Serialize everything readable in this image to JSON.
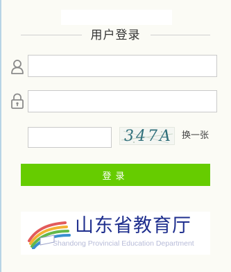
{
  "login": {
    "title": "用户登录",
    "username": {
      "value": "",
      "placeholder": ""
    },
    "password": {
      "value": "",
      "placeholder": ""
    },
    "captcha": {
      "input_value": "",
      "image_text": "347A",
      "refresh_label": "换一张"
    },
    "submit_label": "登录"
  },
  "footer_logo": {
    "chinese_name": "山东省教育厅",
    "english_name": "Shandong Provincial Education Department"
  },
  "colors": {
    "page_background": "#fbfbf5",
    "login_button": "#66cc00",
    "logo_text": "#1f2f8e"
  },
  "icons": {
    "username": "user-icon",
    "password": "lock-icon"
  }
}
